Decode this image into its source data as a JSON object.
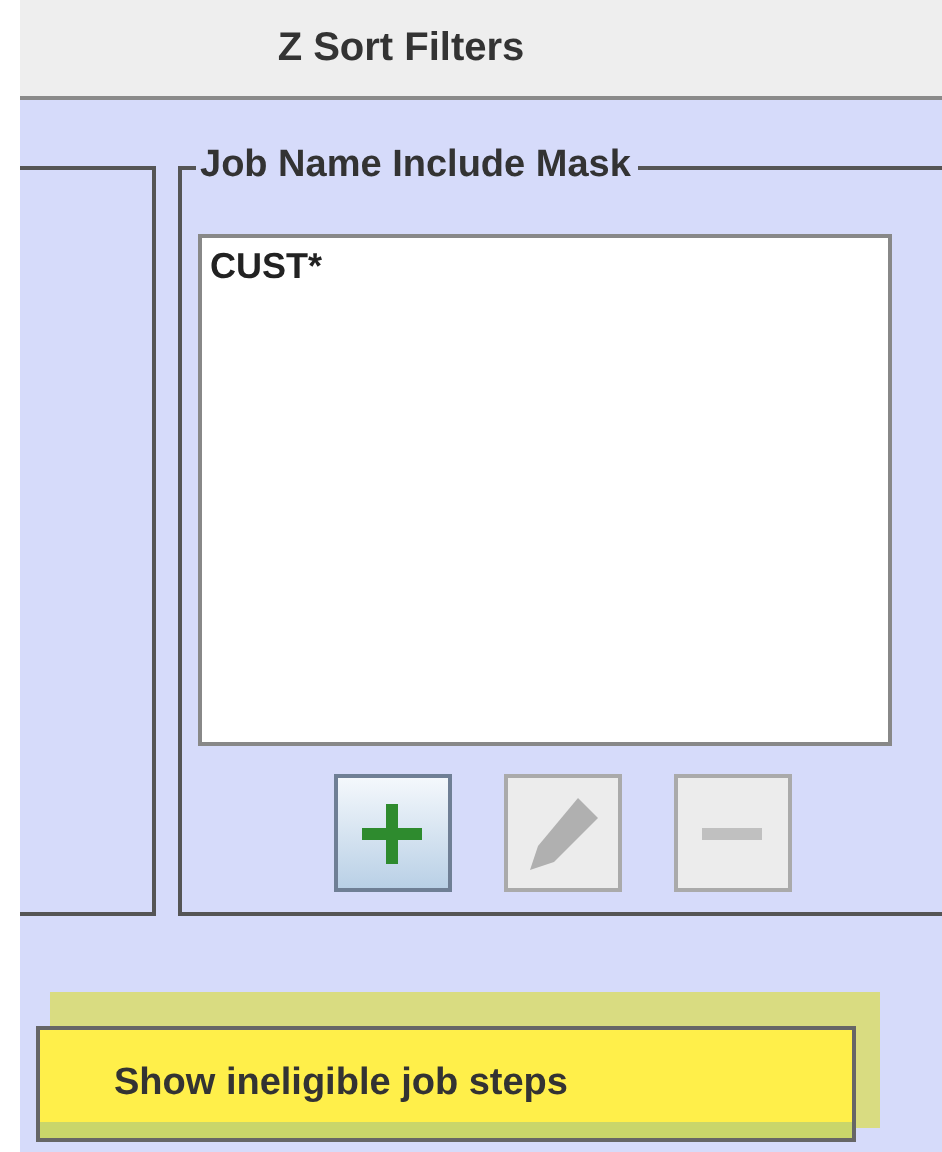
{
  "title": "Z Sort Filters",
  "mask_group": {
    "legend": "Job Name Include Mask",
    "items": [
      {
        "text": "CUST*",
        "selected": false
      }
    ],
    "buttons": [
      {
        "kind": "add",
        "disabled": false
      },
      {
        "kind": "edit",
        "disabled": true
      },
      {
        "kind": "remove",
        "disabled": true
      }
    ]
  },
  "toggle_button": {
    "label": "Show ineligible job steps",
    "highlighted": true
  }
}
